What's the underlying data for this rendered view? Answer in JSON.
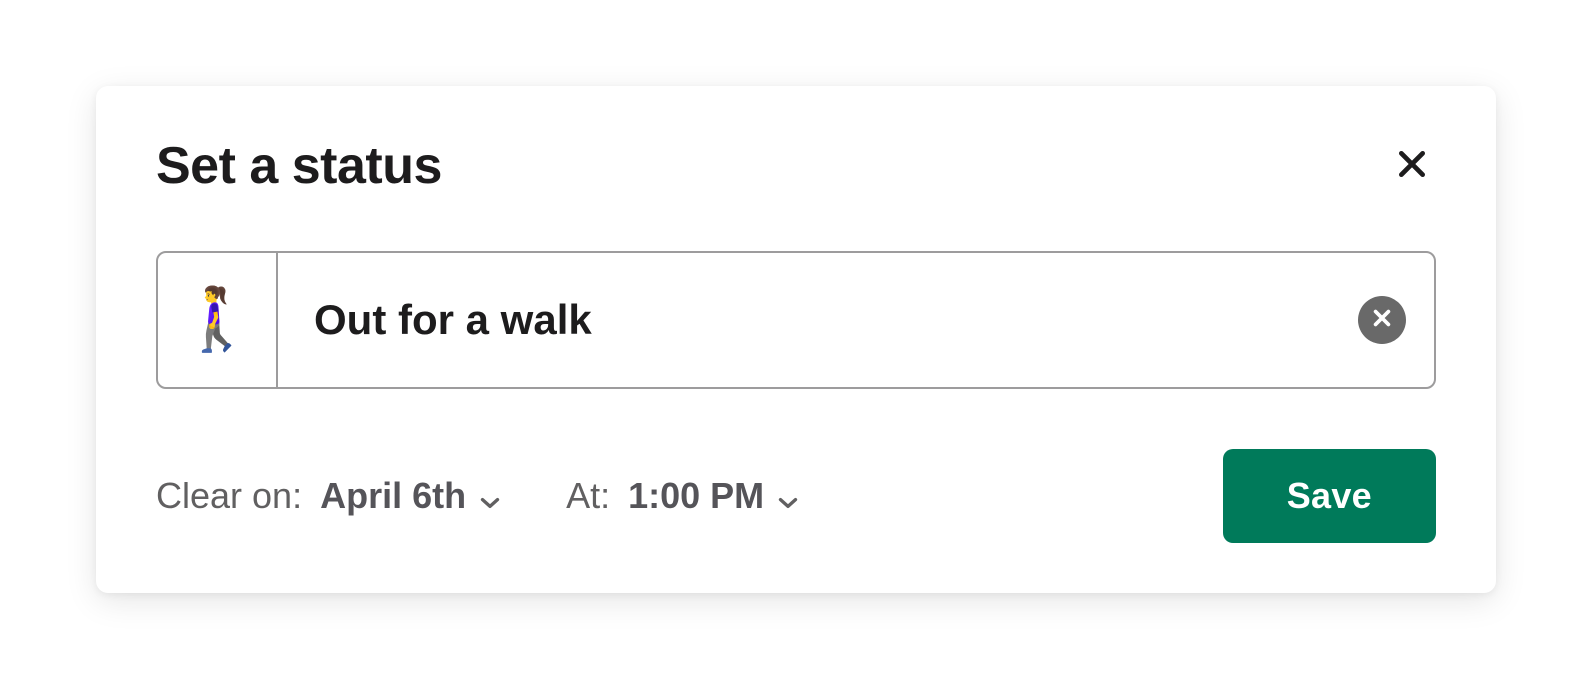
{
  "modal": {
    "title": "Set a status",
    "status": {
      "emoji": "🚶‍♀️",
      "text": "Out for a walk"
    },
    "clear": {
      "label_date": "Clear on:",
      "date": "April 6th",
      "label_time": "At:",
      "time": "1:00 PM"
    },
    "save_label": "Save"
  }
}
